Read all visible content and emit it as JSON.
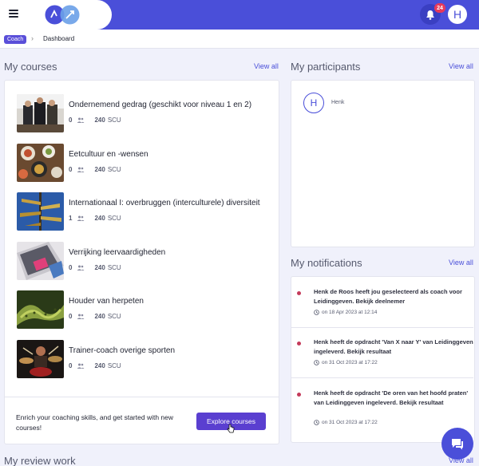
{
  "header": {
    "notification_count": "24",
    "user_initial": "H",
    "colors": {
      "primary": "#4a4fd9",
      "badge": "#e8395a"
    }
  },
  "breadcrumb": {
    "badge": "Coach",
    "page": "Dashboard"
  },
  "my_courses": {
    "title": "My courses",
    "view_all": "View all",
    "items": [
      {
        "title": "Ondernemend gedrag (geschikt voor niveau 1 en 2)",
        "participants": "0",
        "scu": "240",
        "scu_unit": "SCU",
        "thumb": "people-group-photo"
      },
      {
        "title": "Eetcultuur en -wensen",
        "participants": "0",
        "scu": "240",
        "scu_unit": "SCU",
        "thumb": "food-plates-photo"
      },
      {
        "title": "Internationaal I: overbruggen (interculturele) diversiteit",
        "participants": "1",
        "scu": "240",
        "scu_unit": "SCU",
        "thumb": "signpost-photo"
      },
      {
        "title": "Verrijking leervaardigheden",
        "participants": "0",
        "scu": "240",
        "scu_unit": "SCU",
        "thumb": "laptop-desk-photo"
      },
      {
        "title": "Houder van herpeten",
        "participants": "0",
        "scu": "240",
        "scu_unit": "SCU",
        "thumb": "snake-photo"
      },
      {
        "title": "Trainer-coach overige sporten",
        "participants": "0",
        "scu": "240",
        "scu_unit": "SCU",
        "thumb": "drummer-photo"
      }
    ],
    "enrich_text": "Enrich your coaching skills, and get started with new courses!",
    "explore_label": "Explore courses"
  },
  "my_participants": {
    "title": "My participants",
    "view_all": "View all",
    "items": [
      {
        "initial": "H",
        "name": "Henk"
      }
    ]
  },
  "my_notifications": {
    "title": "My notifications",
    "view_all": "View all",
    "items": [
      {
        "text": "Henk de Roos heeft jou geselecteerd als coach voor Leidinggeven. Bekijk deelnemer",
        "time": "on 18 Apr 2023 at 12:14"
      },
      {
        "text": "Henk heeft de opdracht 'Van X naar Y' van Leidinggeven ingeleverd. Bekijk resultaat",
        "time": "on 31 Oct 2023 at 17:22"
      },
      {
        "text": "Henk heeft de opdracht 'De oren van het hoofd praten' van Leidinggeven ingeleverd. Bekijk resultaat",
        "time": "on 31 Oct 2023 at 17:22"
      }
    ]
  },
  "my_review_work": {
    "title": "My review work",
    "view_all": "View all"
  }
}
